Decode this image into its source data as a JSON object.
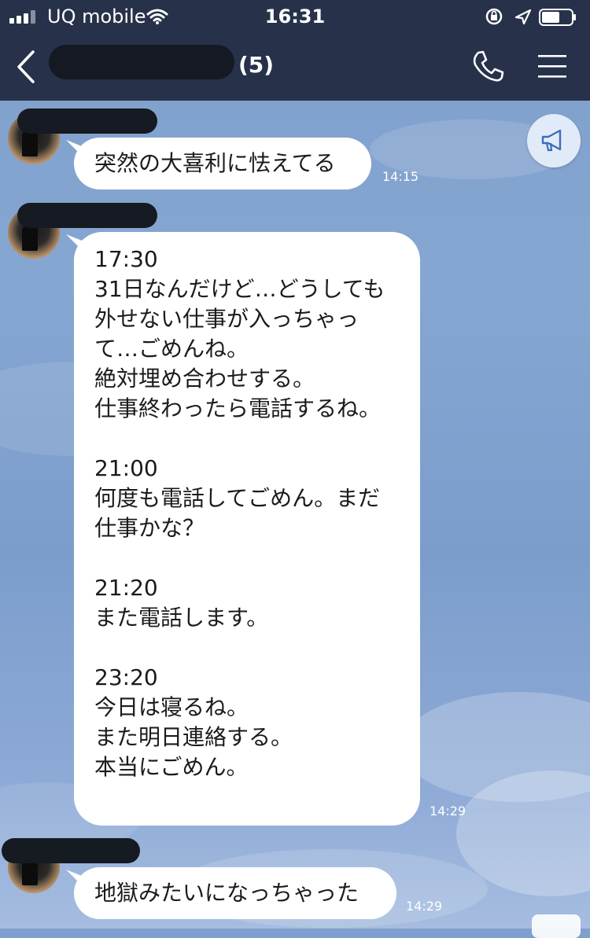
{
  "status_bar": {
    "carrier": "UQ mobile",
    "time": "16:31"
  },
  "header": {
    "member_count": "(5)"
  },
  "messages": [
    {
      "lines": [
        "突然の大喜利に怯えてる"
      ],
      "time": "14:15"
    },
    {
      "lines": [
        "17:30",
        "31日なんだけど…どうしても",
        "外せない仕事が入っちゃっ",
        "て…ごめんね。",
        "絶対埋め合わせする。",
        "仕事終わったら電話するね。",
        "",
        "21:00",
        "何度も電話してごめん。まだ",
        "仕事かな？",
        "",
        "21:20",
        "また電話します。",
        "",
        "23:20",
        "今日は寝るね。",
        "また明日連絡する。",
        "本当にごめん。"
      ],
      "time": "14:29"
    },
    {
      "lines": [
        "地獄みたいになっちゃった"
      ],
      "time": "14:29"
    }
  ],
  "icons": {
    "back": "chevron-left-icon",
    "call": "phone-icon",
    "menu": "hamburger-icon",
    "announcement": "megaphone-icon"
  },
  "colors": {
    "header_bg": "#27324a",
    "chat_bg": "#7f9fcc",
    "bubble_bg": "#ffffff"
  }
}
